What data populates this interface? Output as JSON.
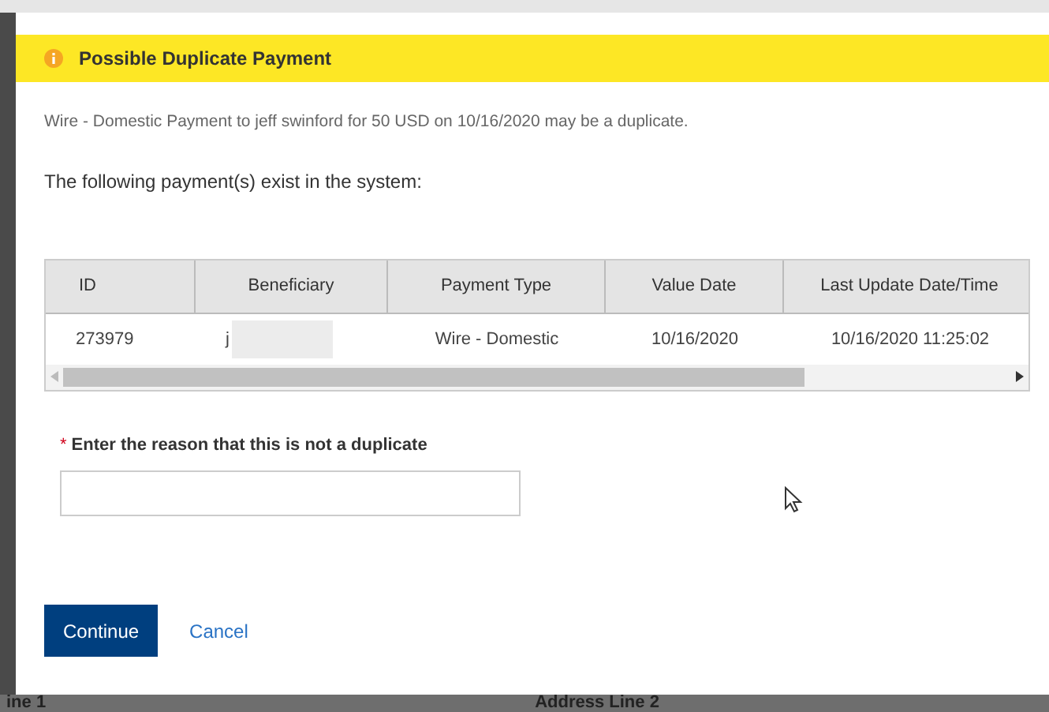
{
  "dialog": {
    "title": "Possible Duplicate Payment",
    "message": "Wire - Domestic Payment to jeff swinford for 50 USD on 10/16/2020 may be a duplicate.",
    "subheading": "The following payment(s) exist in the system:"
  },
  "table": {
    "columns": [
      "ID",
      "Beneficiary",
      "Payment Type",
      "Value Date",
      "Last Update Date/Time"
    ],
    "rows": [
      [
        "273979",
        "j",
        "Wire - Domestic",
        "10/16/2020",
        "10/16/2020 11:25:02"
      ]
    ]
  },
  "reason_field": {
    "required_mark": "*",
    "label": "Enter the reason that this is not a duplicate"
  },
  "buttons": [
    {
      "kind": "primary",
      "label": "Continue"
    },
    {
      "kind": "link",
      "label": "Cancel"
    }
  ],
  "background_labels": [
    "ine 1",
    "Address Line 2"
  ]
}
